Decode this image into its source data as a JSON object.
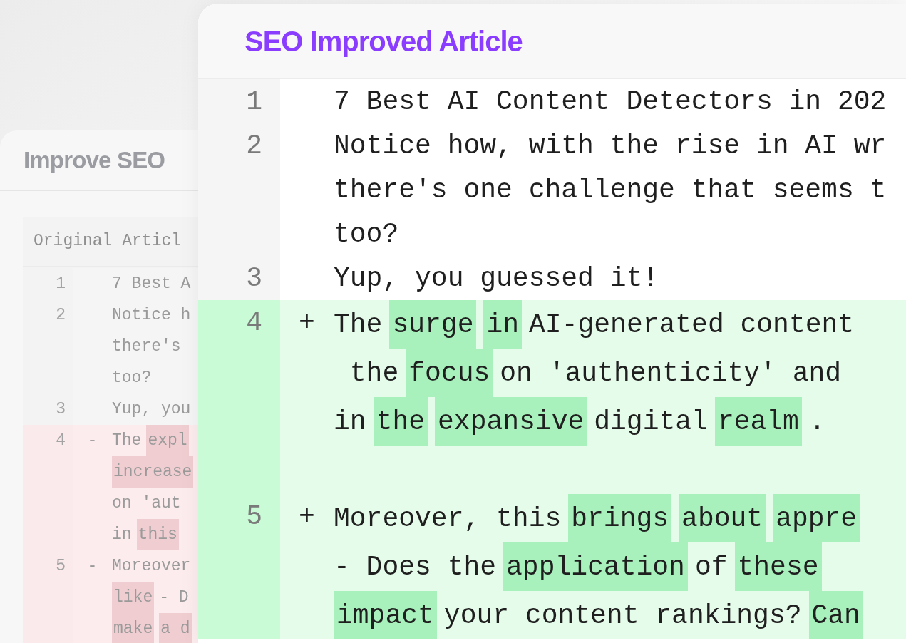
{
  "original_panel": {
    "title": "Improve SEO",
    "subtitle": "Original Articl",
    "lines": [
      {
        "number": "1",
        "kind": "context",
        "rows": [
          [
            {
              "text": "7 Best A",
              "highlight": false
            }
          ]
        ]
      },
      {
        "number": "2",
        "kind": "context",
        "rows": [
          [
            {
              "text": "Notice h",
              "highlight": false
            }
          ],
          [
            {
              "text": "there's",
              "highlight": false
            }
          ],
          [
            {
              "text": "too?",
              "highlight": false
            }
          ]
        ]
      },
      {
        "number": "3",
        "kind": "context",
        "rows": [
          [
            {
              "text": "Yup, you",
              "highlight": false
            }
          ]
        ]
      },
      {
        "number": "4",
        "kind": "removed",
        "sign": "-",
        "rows": [
          [
            {
              "text": "The",
              "highlight": false
            },
            {
              "text": "expl",
              "highlight": true
            }
          ],
          [
            {
              "text": "increase",
              "highlight": true
            }
          ],
          [
            {
              "text": "on 'aut",
              "highlight": false
            }
          ],
          [
            {
              "text": "in",
              "highlight": false
            },
            {
              "text": "this",
              "highlight": true
            }
          ]
        ]
      },
      {
        "number": "5",
        "kind": "removed",
        "sign": "-",
        "rows": [
          [
            {
              "text": "Moreover",
              "highlight": false
            }
          ],
          [
            {
              "text": "like",
              "highlight": true
            },
            {
              "text": "- D",
              "highlight": false
            }
          ],
          [
            {
              "text": "make",
              "highlight": true
            },
            {
              "text": "a d",
              "highlight": true
            }
          ]
        ]
      }
    ]
  },
  "improved_panel": {
    "title": "SEO Improved Article",
    "lines": [
      {
        "number": "1",
        "kind": "context",
        "rows": [
          [
            {
              "text": "7 Best AI Content Detectors in 202",
              "highlight": false
            }
          ]
        ]
      },
      {
        "number": "2",
        "kind": "context",
        "rows": [
          [
            {
              "text": "Notice how, with the rise in AI wr",
              "highlight": false
            }
          ],
          [
            {
              "text": "there's one challenge that seems t",
              "highlight": false
            }
          ],
          [
            {
              "text": "too?",
              "highlight": false
            }
          ]
        ]
      },
      {
        "number": "3",
        "kind": "context",
        "rows": [
          [
            {
              "text": "Yup, you guessed it!",
              "highlight": false
            }
          ]
        ]
      },
      {
        "number": "4",
        "kind": "added",
        "sign": "+",
        "rows": [
          [
            {
              "text": "The",
              "highlight": false
            },
            {
              "text": "surge",
              "highlight": true
            },
            {
              "text": "in",
              "highlight": true
            },
            {
              "text": "AI-generated content",
              "highlight": false
            }
          ],
          [
            {
              "text": " the",
              "highlight": false
            },
            {
              "text": "focus",
              "highlight": true
            },
            {
              "text": "on 'authenticity' and",
              "highlight": false
            }
          ],
          [
            {
              "text": "in",
              "highlight": false
            },
            {
              "text": "the",
              "highlight": true
            },
            {
              "text": "expansive",
              "highlight": true
            },
            {
              "text": "digital",
              "highlight": false
            },
            {
              "text": "realm",
              "highlight": true
            },
            {
              "text": ".",
              "highlight": false
            }
          ],
          []
        ]
      },
      {
        "number": "5",
        "kind": "added",
        "sign": "+",
        "rows": [
          [
            {
              "text": "Moreover, this",
              "highlight": false
            },
            {
              "text": "brings",
              "highlight": true
            },
            {
              "text": "about",
              "highlight": true
            },
            {
              "text": "appre",
              "highlight": true
            }
          ],
          [
            {
              "text": "- Does the",
              "highlight": false
            },
            {
              "text": "application",
              "highlight": true
            },
            {
              "text": "of",
              "highlight": false
            },
            {
              "text": "these",
              "highlight": true
            }
          ],
          [
            {
              "text": "impact",
              "highlight": true
            },
            {
              "text": "your content rankings?",
              "highlight": false
            },
            {
              "text": "Can",
              "highlight": true
            }
          ]
        ]
      }
    ]
  }
}
